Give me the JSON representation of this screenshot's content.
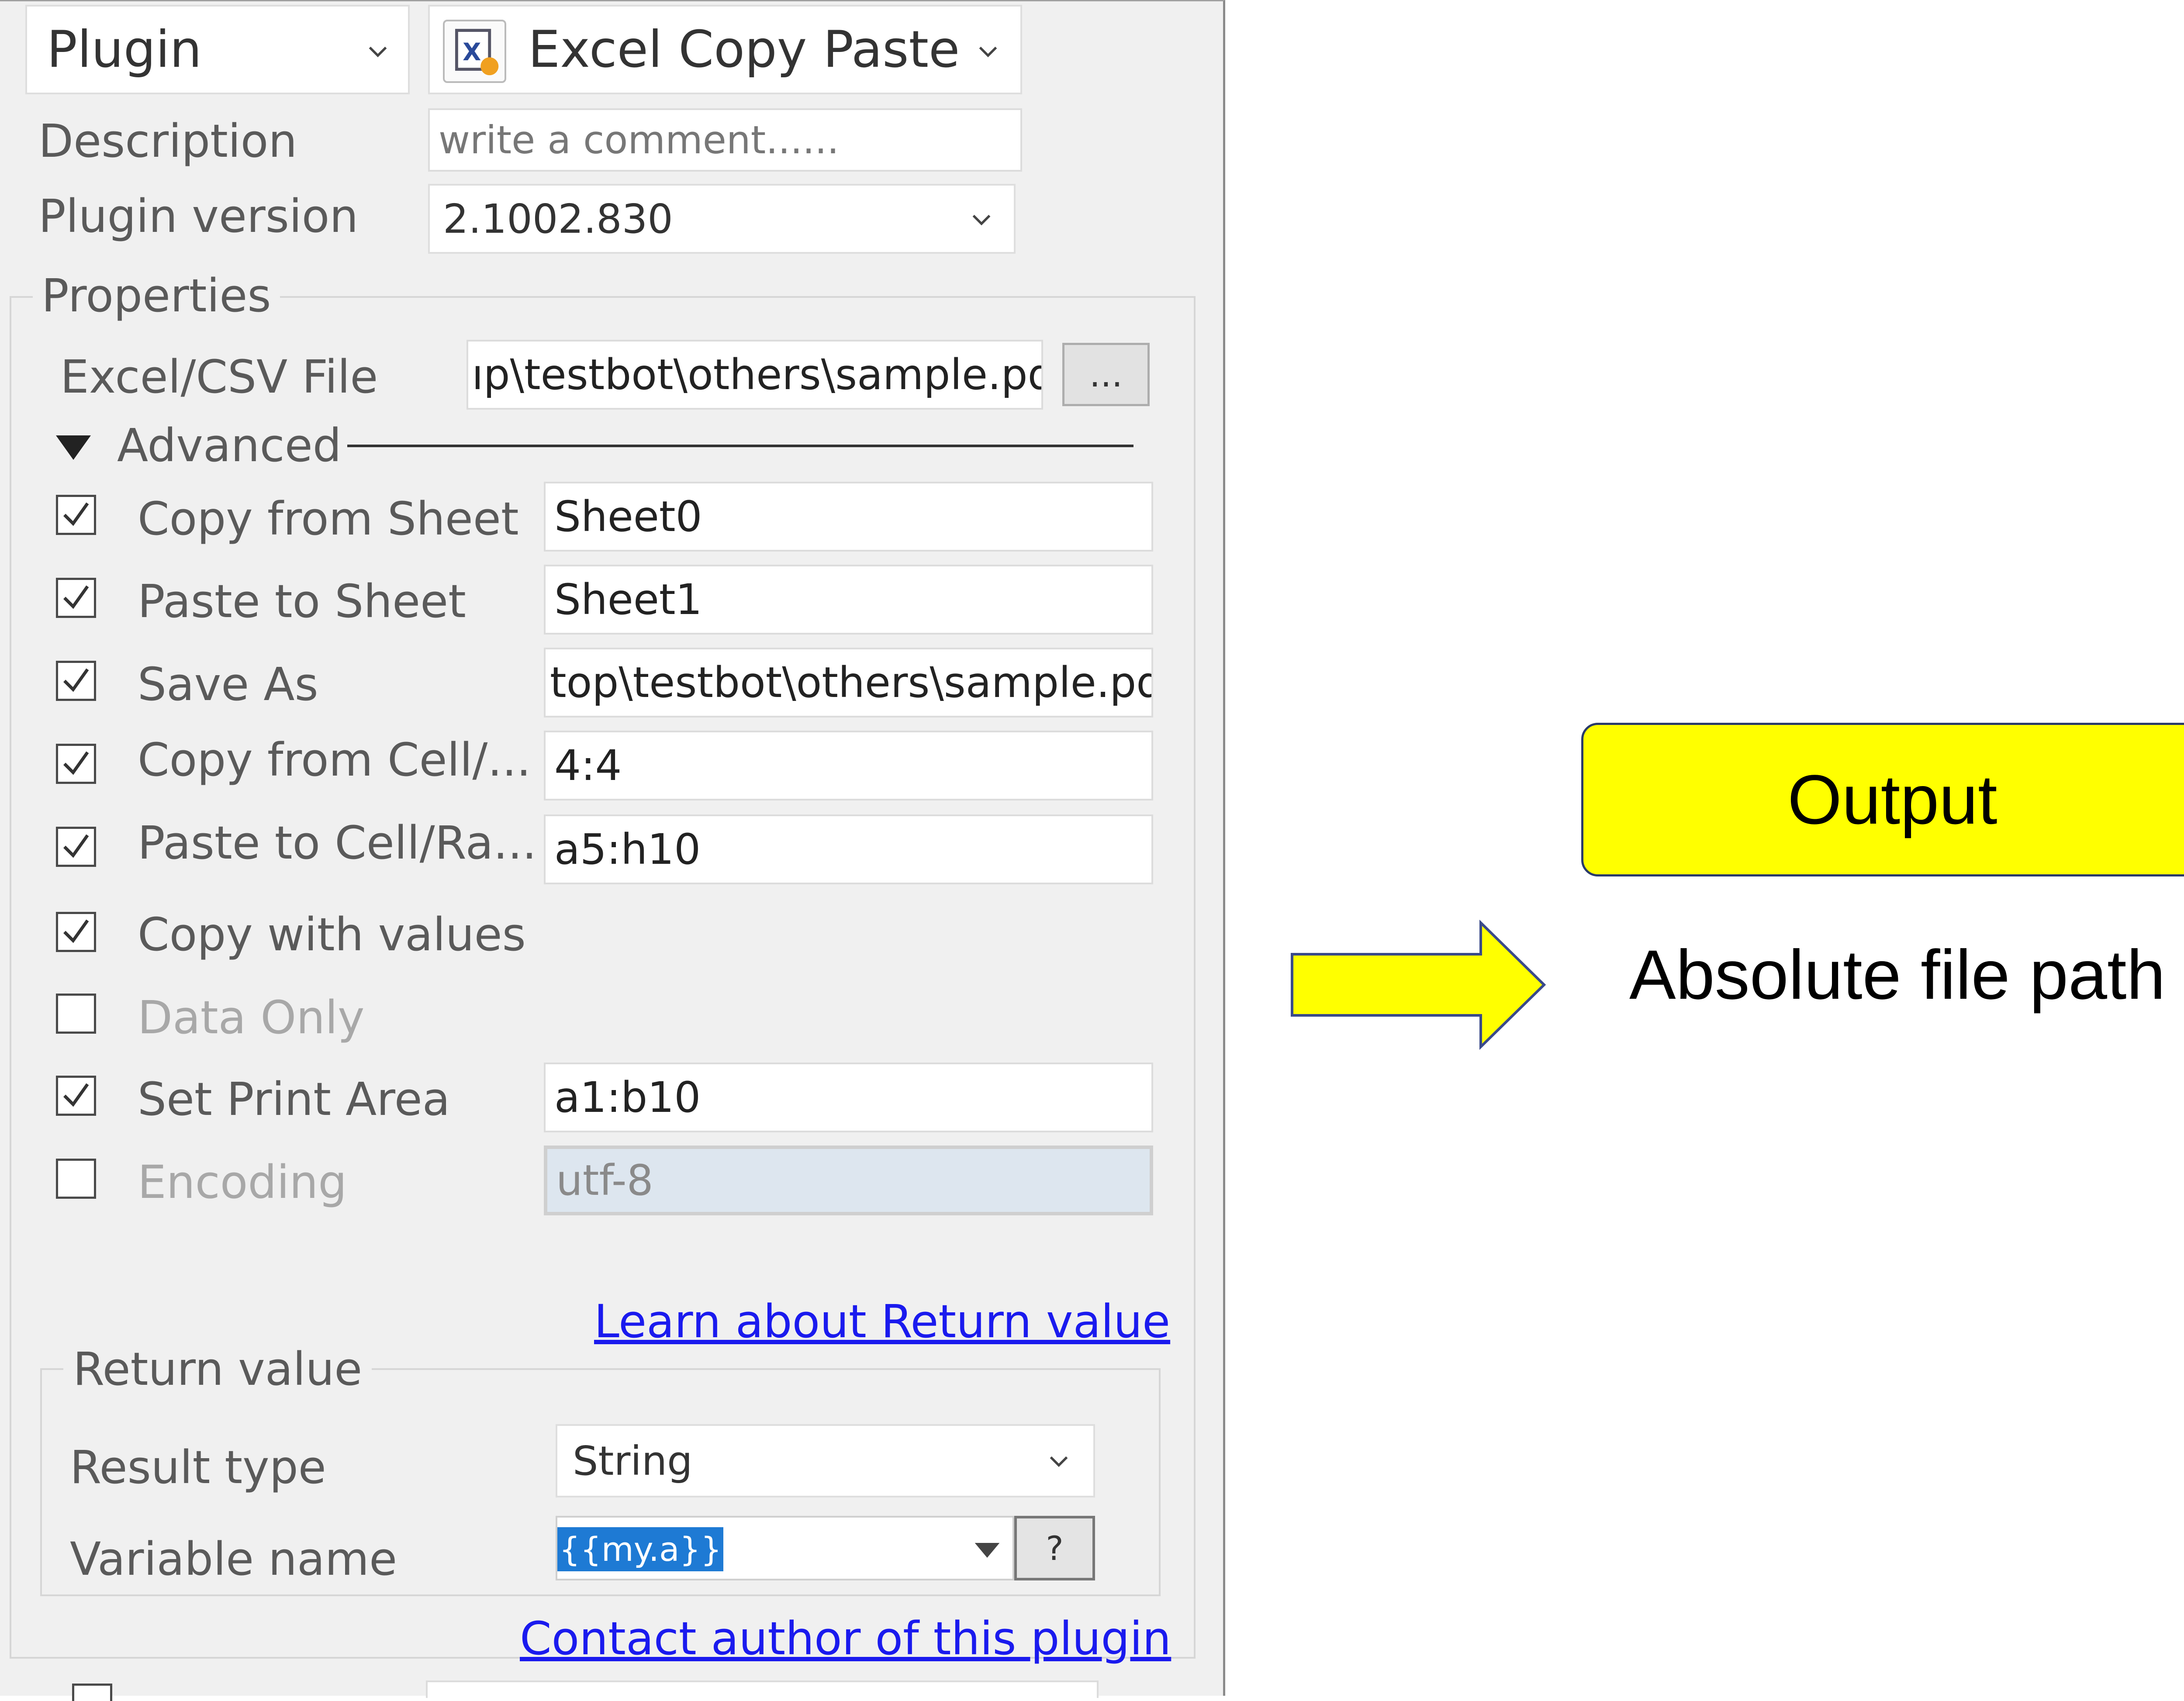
{
  "header": {
    "mode_label": "Plugin",
    "plugin_name": "Excel Copy Paste",
    "plugin_icon": "excel-plugin-icon"
  },
  "description": {
    "label": "Description",
    "placeholder": "write a comment......"
  },
  "version": {
    "label": "Plugin version",
    "value": "2.1002.830"
  },
  "properties": {
    "title": "Properties",
    "file": {
      "label": "Excel/CSV File",
      "value": "ıp\\testbot\\others\\sample.pdf",
      "browse_label": "..."
    },
    "advanced_label": "Advanced",
    "rows": [
      {
        "label": "Copy from Sheet",
        "checked": true,
        "value": "Sheet0"
      },
      {
        "label": "Paste to Sheet",
        "checked": true,
        "value": "Sheet1"
      },
      {
        "label": "Save As",
        "checked": true,
        "value": "top\\testbot\\others\\sample.pdf"
      },
      {
        "label": "Copy from Cell/...",
        "checked": true,
        "value": "4:4"
      },
      {
        "label": "Paste to Cell/Ra...",
        "checked": true,
        "value": "a5:h10"
      },
      {
        "label": "Copy with values",
        "checked": true
      },
      {
        "label": "Data Only",
        "checked": false
      },
      {
        "label": "Set Print Area",
        "checked": true,
        "value": "a1:b10"
      },
      {
        "label": "Encoding",
        "checked": false,
        "value": "utf-8"
      }
    ]
  },
  "learn_link": "Learn about Return value",
  "return_value": {
    "title": "Return value",
    "result_type_label": "Result type",
    "result_type_value": "String",
    "variable_label": "Variable name",
    "variable_value": "{{my.a}}",
    "help_label": "?"
  },
  "contact_link": "Contact author of this plugin",
  "annotation": {
    "box_text": "Output",
    "caption": "Absolute file path",
    "box_color": "#ffff00",
    "arrow_color": "#ffff00"
  }
}
